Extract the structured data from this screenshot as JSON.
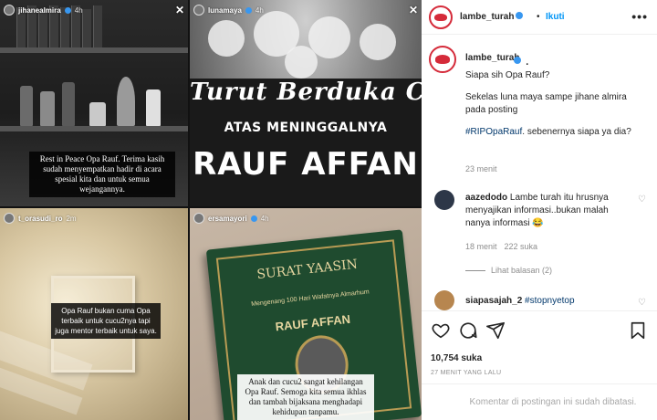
{
  "stories": {
    "story1": {
      "username": "jihanealmira",
      "time": "4h",
      "close": "✕",
      "caption": "Rest in Peace Opa Rauf. Terima kasih sudah menyempatkan hadir di acara spesial kita dan untuk semua wejangannya."
    },
    "story2": {
      "username": "lunamaya",
      "time": "4h",
      "close": "✕",
      "sign_line1": "Turut Berduka Cita",
      "sign_line2": "ATAS MENINGGALNYA",
      "sign_line3": "RAUF AFFAN"
    },
    "story3": {
      "username": "t_orasudi_ro",
      "time": "2m",
      "caption": "Opa Rauf bukan cuma Opa terbaik untuk cucu2nya tapi juga mentor terbaik untuk saya."
    },
    "story4": {
      "username": "ersamayori",
      "time": "4h",
      "book_title": "SURAT YAASIN",
      "book_subtitle": "Mengenang 100 Hari Wafatnya Almarhum",
      "book_name": "RAUF AFFAN",
      "caption": "Anak dan cucu2 sangat kehilangan Opa Rauf. Semoga kita semua ikhlas dan tambah bijaksana menghadapi kehidupan tanpamu."
    }
  },
  "header": {
    "username": "lambe_turah",
    "separator": "•",
    "follow_label": "Ikuti",
    "more_label": "•••"
  },
  "post": {
    "username": "lambe_turah",
    "after_name": ".",
    "line1": "Siapa sih Opa Rauf?",
    "line2": "Sekelas luna maya sampe jihane almira pada posting",
    "hashtag": "#RIPOpaRauf",
    "line3": ". sebenernya siapa ya dia?",
    "time": "23 menit"
  },
  "comments": [
    {
      "username": "aazedodo",
      "text": "Lambe turah itu hrusnya menyajikan informasi..bukan malah nanya informasi 😂",
      "time": "18 menit",
      "likes": "222 suka",
      "replies": "Lihat balasan (2)"
    },
    {
      "username": "siapasajah_2",
      "text": "#stopnyetop"
    }
  ],
  "footer": {
    "likes": "10,754 suka",
    "posted": "27 MENIT YANG LALU",
    "comments_closed": "Komentar di postingan ini sudah dibatasi."
  },
  "colors": {
    "accent": "#0095f6",
    "brand": "#d52b3a",
    "hashtag": "#00376b",
    "muted": "#8e8e8e"
  },
  "icons": [
    "heart-icon",
    "comment-icon",
    "share-icon",
    "bookmark-icon",
    "more-icon",
    "verified-icon"
  ]
}
